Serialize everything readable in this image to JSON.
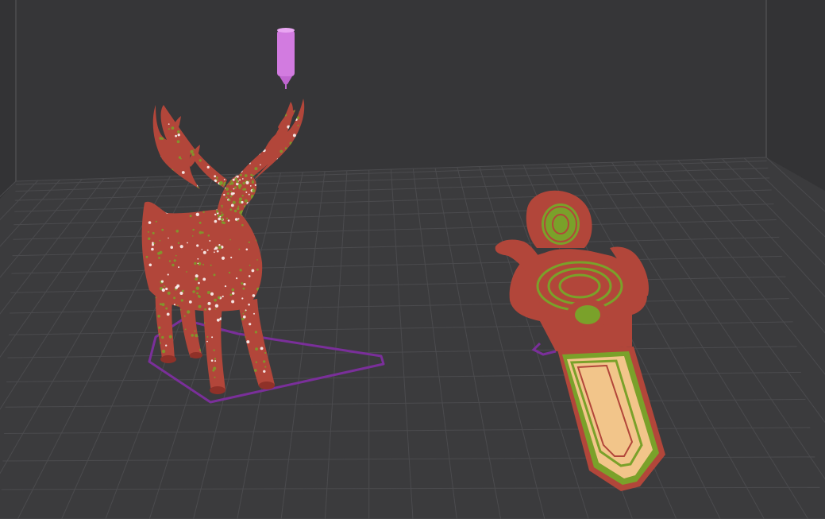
{
  "app": {
    "view": "3d-slice-preview"
  },
  "colors": {
    "background_wall": "#363638",
    "wall_edge": "#464649",
    "bed": "#3b3b3d",
    "grid_line": "#4b4b4e",
    "skirt": "#7a2f9a",
    "perimeter_red": "#b2463a",
    "infill_green": "#7aa12a",
    "top_infill_cream": "#f2c58a",
    "travel_highlight": "#ffffff",
    "nozzle": "#d27be0"
  },
  "objects": [
    {
      "name": "deer-model",
      "icon": "deer-icon",
      "selected": false
    },
    {
      "name": "bookmark-model",
      "icon": "bookmark-icon",
      "selected": false
    }
  ],
  "tool": {
    "name": "nozzle",
    "icon": "nozzle-icon"
  }
}
